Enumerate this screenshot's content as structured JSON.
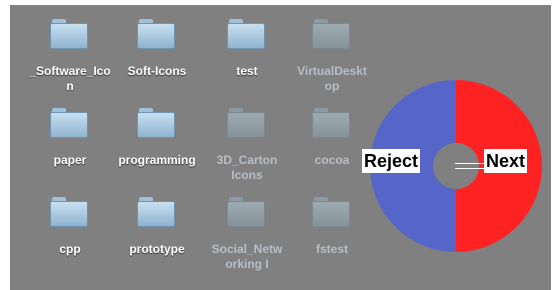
{
  "desktop": {
    "icons": [
      {
        "label": "_Software_Icon",
        "state": "normal",
        "icon": "folder-icon"
      },
      {
        "label": "Soft-Icons",
        "state": "normal",
        "icon": "folder-icon"
      },
      {
        "label": "test",
        "state": "normal",
        "icon": "folder-icon"
      },
      {
        "label": "VirtualDesktop",
        "state": "dimmed",
        "icon": "folder-icon"
      },
      {
        "label": "paper",
        "state": "normal",
        "icon": "folder-icon"
      },
      {
        "label": "programming",
        "state": "normal",
        "icon": "folder-icon"
      },
      {
        "label": "3D_Carton Icons",
        "state": "dimmed",
        "icon": "folder-icon"
      },
      {
        "label": "cocoa",
        "state": "dimmed",
        "icon": "folder-icon"
      },
      {
        "label": "cpp",
        "state": "normal",
        "icon": "folder-icon"
      },
      {
        "label": "prototype",
        "state": "normal",
        "icon": "folder-icon"
      },
      {
        "label": "Social_Networking I",
        "state": "dimmed",
        "icon": "folder-icon"
      },
      {
        "label": "fstest",
        "state": "dimmed",
        "icon": "folder-icon"
      }
    ]
  },
  "pie_menu": {
    "left_option": "Reject",
    "right_option": "Next",
    "colors": {
      "left": "#5566c8",
      "right": "#ff2222"
    }
  }
}
